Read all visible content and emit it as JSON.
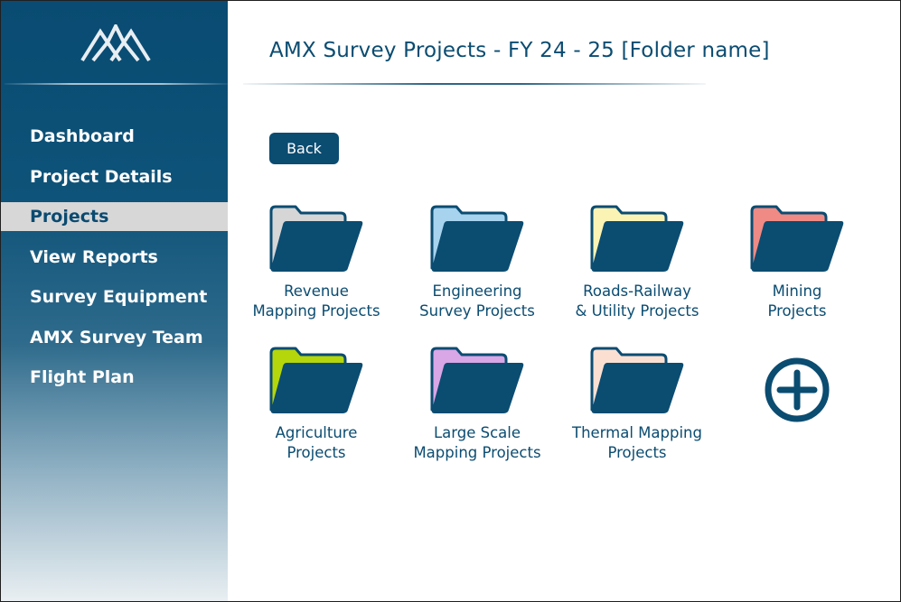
{
  "sidebar": {
    "logo_icon": "mountain-logo-icon",
    "items": [
      {
        "label": "Dashboard",
        "active": false
      },
      {
        "label": "Project Details",
        "active": false
      },
      {
        "label": "Projects",
        "active": true
      },
      {
        "label": "View Reports",
        "active": false
      },
      {
        "label": "Survey Equipment",
        "active": false
      },
      {
        "label": "AMX Survey Team",
        "active": false
      },
      {
        "label": "Flight Plan",
        "active": false
      }
    ]
  },
  "main": {
    "title": "AMX Survey Projects - FY 24 - 25 [Folder name]",
    "back_label": "Back",
    "folders": [
      {
        "label": "Revenue\nMapping Projects",
        "tab_color": "#d6d6d6",
        "icon": "folder-icon"
      },
      {
        "label": "Engineering\nSurvey Projects",
        "tab_color": "#a7d3ef",
        "icon": "folder-icon"
      },
      {
        "label": "Roads-Railway\n& Utility Projects",
        "tab_color": "#fbf3b4",
        "icon": "folder-icon"
      },
      {
        "label": "Mining\nProjects",
        "tab_color": "#f08a84",
        "icon": "folder-icon"
      },
      {
        "label": "Agriculture\nProjects",
        "tab_color": "#b5d60a",
        "icon": "folder-icon"
      },
      {
        "label": "Large Scale\nMapping Projects",
        "tab_color": "#d9a6e6",
        "icon": "folder-icon"
      },
      {
        "label": "Thermal Mapping\nProjects",
        "tab_color": "#fbe0d2",
        "icon": "folder-icon"
      }
    ],
    "add_icon": "plus-circle-icon"
  },
  "colors": {
    "brand": "#0b4c71",
    "active_nav_bg": "#d7d7d7"
  }
}
